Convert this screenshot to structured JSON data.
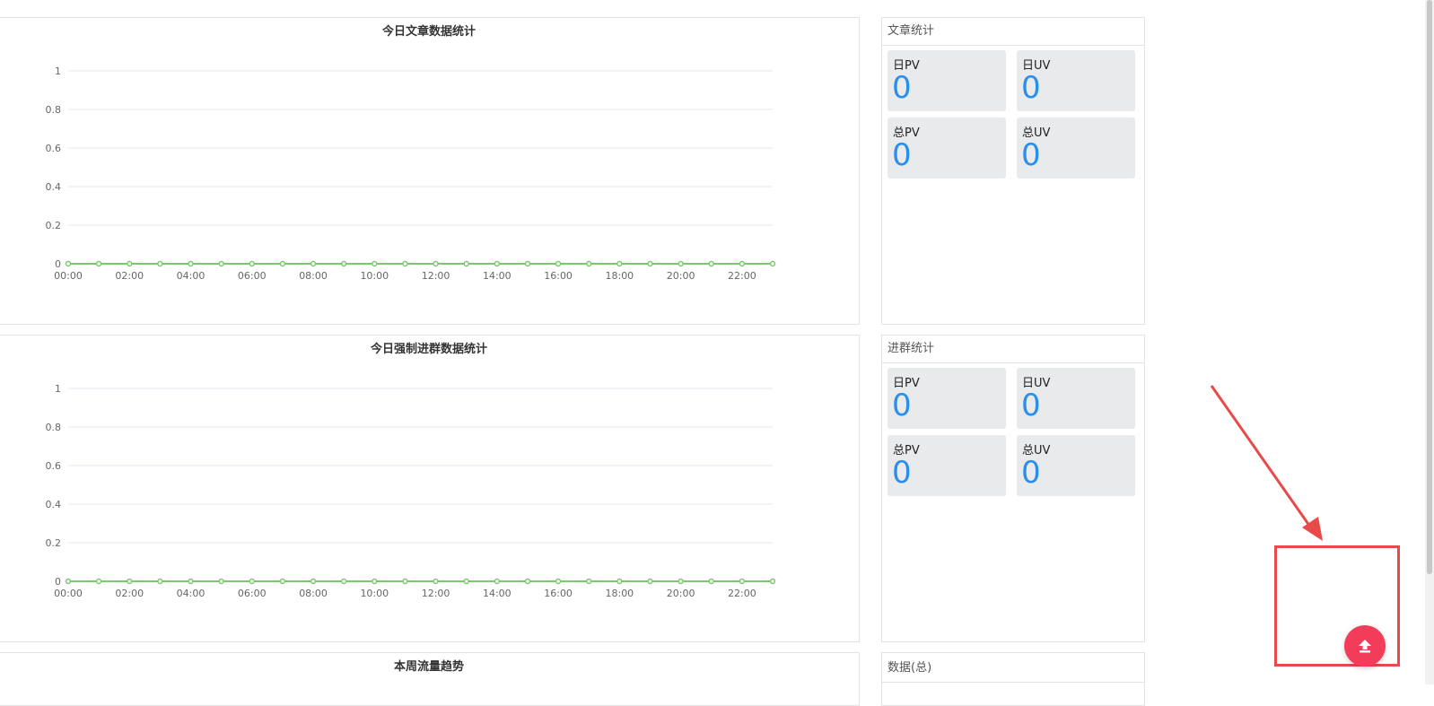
{
  "charts": [
    {
      "title": "今日文章数据统计",
      "chart_data": {
        "type": "line",
        "x": [
          "00:00",
          "01:00",
          "02:00",
          "03:00",
          "04:00",
          "05:00",
          "06:00",
          "07:00",
          "08:00",
          "09:00",
          "10:00",
          "11:00",
          "12:00",
          "13:00",
          "14:00",
          "15:00",
          "16:00",
          "17:00",
          "18:00",
          "19:00",
          "20:00",
          "21:00",
          "22:00",
          "23:00"
        ],
        "xticks": [
          "00:00",
          "02:00",
          "04:00",
          "06:00",
          "08:00",
          "10:00",
          "12:00",
          "14:00",
          "16:00",
          "18:00",
          "20:00",
          "22:00"
        ],
        "series": [
          {
            "values": [
              0,
              0,
              0,
              0,
              0,
              0,
              0,
              0,
              0,
              0,
              0,
              0,
              0,
              0,
              0,
              0,
              0,
              0,
              0,
              0,
              0,
              0,
              0,
              0
            ],
            "color": "#7bc96f"
          }
        ],
        "yticks": [
          "0",
          "0.2",
          "0.4",
          "0.6",
          "0.8",
          "1"
        ],
        "ylim": [
          0,
          1
        ],
        "grid": true
      }
    },
    {
      "title": "今日强制进群数据统计",
      "chart_data": {
        "type": "line",
        "x": [
          "00:00",
          "01:00",
          "02:00",
          "03:00",
          "04:00",
          "05:00",
          "06:00",
          "07:00",
          "08:00",
          "09:00",
          "10:00",
          "11:00",
          "12:00",
          "13:00",
          "14:00",
          "15:00",
          "16:00",
          "17:00",
          "18:00",
          "19:00",
          "20:00",
          "21:00",
          "22:00",
          "23:00"
        ],
        "xticks": [
          "00:00",
          "02:00",
          "04:00",
          "06:00",
          "08:00",
          "10:00",
          "12:00",
          "14:00",
          "16:00",
          "18:00",
          "20:00",
          "22:00"
        ],
        "series": [
          {
            "values": [
              0,
              0,
              0,
              0,
              0,
              0,
              0,
              0,
              0,
              0,
              0,
              0,
              0,
              0,
              0,
              0,
              0,
              0,
              0,
              0,
              0,
              0,
              0,
              0
            ],
            "color": "#7bc96f"
          }
        ],
        "yticks": [
          "0",
          "0.2",
          "0.4",
          "0.6",
          "0.8",
          "1"
        ],
        "ylim": [
          0,
          1
        ],
        "grid": true
      }
    },
    {
      "title": "本周流量趋势"
    }
  ],
  "article_stats": {
    "header": "文章统计",
    "cards": [
      {
        "label": "日PV",
        "value": "0"
      },
      {
        "label": "日UV",
        "value": "0"
      },
      {
        "label": "总PV",
        "value": "0"
      },
      {
        "label": "总UV",
        "value": "0"
      }
    ]
  },
  "group_stats": {
    "header": "进群统计",
    "cards": [
      {
        "label": "日PV",
        "value": "0"
      },
      {
        "label": "日UV",
        "value": "0"
      },
      {
        "label": "总PV",
        "value": "0"
      },
      {
        "label": "总UV",
        "value": "0"
      }
    ]
  },
  "total_stats": {
    "header": "数据(总)"
  },
  "colors": {
    "accent_value": "#2a8ef0",
    "line": "#7bc96f",
    "back_to_top": "#f23c5a",
    "annotation": "#e84a4a"
  },
  "icons": {
    "back_to_top": "upload-arrow-icon"
  }
}
